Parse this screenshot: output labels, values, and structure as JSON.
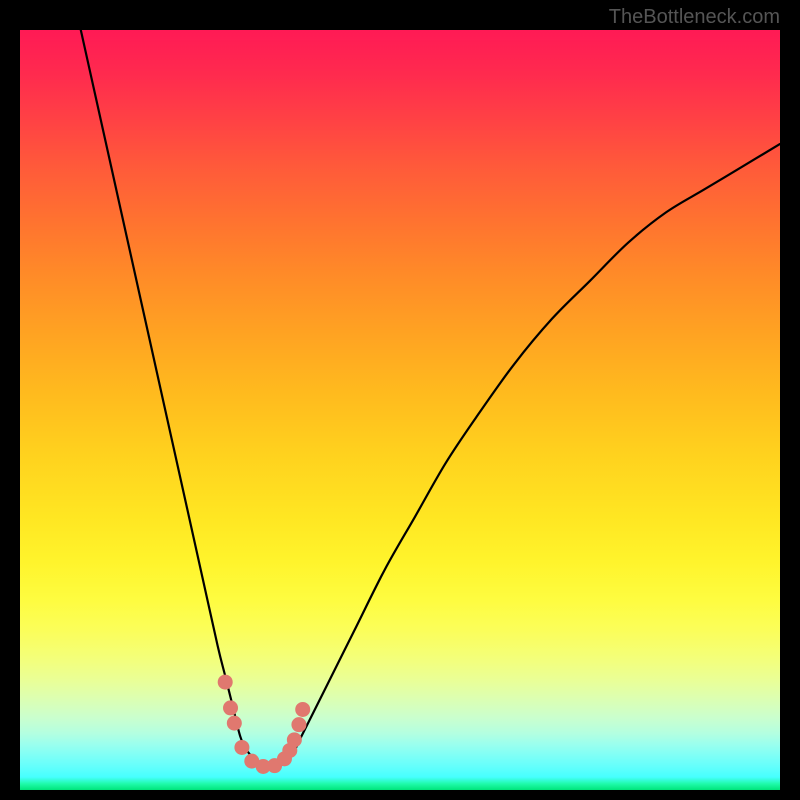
{
  "watermark": "TheBottleneck.com",
  "chart_data": {
    "type": "line",
    "title": "",
    "xlabel": "",
    "ylabel": "",
    "xlim": [
      0,
      100
    ],
    "ylim": [
      0,
      100
    ],
    "grid": false,
    "legend": false,
    "notes": "Bottleneck chart: V-shaped curve on rainbow gradient. Y represents bottleneck severity (0 green optimal, 100 red worst). X is relative component balance. Minimum plateau ~x=29..36 at y≈3. Axes and ticks are hidden; values estimated from geometry.",
    "series": [
      {
        "name": "bottleneck-curve",
        "x": [
          8,
          10,
          12,
          14,
          16,
          18,
          20,
          22,
          24,
          26,
          27,
          28,
          29,
          30,
          32,
          34,
          35,
          36,
          37,
          38,
          40,
          44,
          48,
          52,
          56,
          60,
          65,
          70,
          75,
          80,
          85,
          90,
          95,
          100
        ],
        "y": [
          100,
          91,
          82,
          73,
          64,
          55,
          46,
          37,
          28,
          19,
          15,
          11,
          7,
          5,
          3,
          3,
          4,
          5,
          7,
          9,
          13,
          21,
          29,
          36,
          43,
          49,
          56,
          62,
          67,
          72,
          76,
          79,
          82,
          85
        ]
      },
      {
        "name": "highlight-dots",
        "x": [
          27.0,
          27.7,
          28.2,
          29.2,
          30.5,
          32.0,
          33.5,
          34.8,
          35.5,
          36.1,
          36.7,
          37.2
        ],
        "y": [
          14.2,
          10.8,
          8.8,
          5.6,
          3.8,
          3.1,
          3.2,
          4.1,
          5.2,
          6.6,
          8.6,
          10.6
        ]
      }
    ],
    "gradient_stops": [
      {
        "pos": 0.0,
        "color": "#ff1a55"
      },
      {
        "pos": 0.25,
        "color": "#ff7230"
      },
      {
        "pos": 0.5,
        "color": "#ffc81e"
      },
      {
        "pos": 0.75,
        "color": "#fefc40"
      },
      {
        "pos": 0.9,
        "color": "#caffce"
      },
      {
        "pos": 1.0,
        "color": "#00e47a"
      }
    ],
    "colors": {
      "curve": "#000000",
      "dots": "#e0786f",
      "background_frame": "#000000"
    }
  }
}
